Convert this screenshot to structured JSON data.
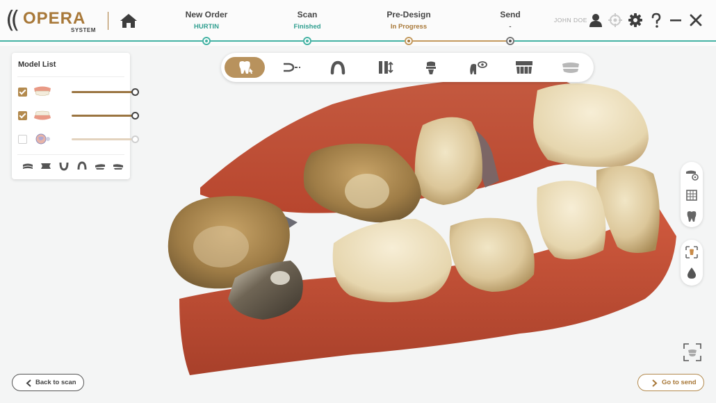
{
  "brand": {
    "name": "OPERA",
    "subtitle": "SYSTEM"
  },
  "steps": [
    {
      "title": "New Order",
      "status": "HURTIN",
      "status_color": "#2f9e8f"
    },
    {
      "title": "Scan",
      "status": "Finished",
      "status_color": "#2f9e8f"
    },
    {
      "title": "Pre-Design",
      "status": "In Progress",
      "status_color": "#a87838"
    },
    {
      "title": "Send",
      "status": "-",
      "status_color": "#555555"
    }
  ],
  "user": {
    "name": "JOHN DOE"
  },
  "toolbar": {
    "tools": [
      "tooth-select",
      "margin-line",
      "arch",
      "tooth-axis",
      "abutment",
      "insertion-view",
      "grid-model",
      "bite-model"
    ],
    "active_index": 0
  },
  "model_list": {
    "title": "Model List",
    "models": [
      {
        "name": "upper-jaw",
        "checked": true,
        "opacity": 1.0
      },
      {
        "name": "lower-jaw",
        "checked": true,
        "opacity": 1.0
      },
      {
        "name": "bite-scan",
        "checked": false,
        "opacity": 1.0
      }
    ],
    "view_presets": [
      "view-top",
      "view-front",
      "view-bottom",
      "view-back",
      "view-left",
      "view-right"
    ]
  },
  "side_tools": [
    "model-settings",
    "grid-view",
    "tooth-view",
    "occlusion-map",
    "color-drop"
  ],
  "buttons": {
    "back": "Back to scan",
    "next": "Go to send"
  },
  "colors": {
    "accent": "#b38a4e",
    "progress": "#45b3a4",
    "background": "#f4f5f5"
  }
}
